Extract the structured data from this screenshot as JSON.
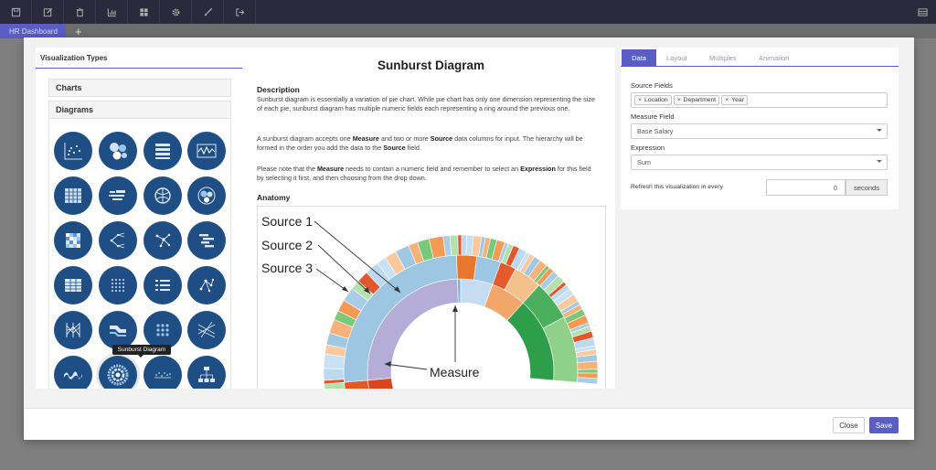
{
  "toolbar": {
    "buttons": [
      "save-icon",
      "edit-icon",
      "trash-icon",
      "bar-chart-icon",
      "dashboard-icon",
      "gear-icon",
      "brush-icon",
      "export-icon"
    ],
    "right_button": "menu-icon"
  },
  "tabbar": {
    "dashboard_tab": "HR Dashboard",
    "add_label": "+"
  },
  "left": {
    "title": "Visualization Types",
    "sections": [
      "Charts",
      "Diagrams"
    ],
    "tooltip": "Sunburst Diagram"
  },
  "main": {
    "title": "Sunburst Diagram",
    "description_heading": "Description",
    "paragraph1": "Sunburst diagram is essentially a variation of pie chart. While pie chart has only one dimension representing the size of each pie, sunburst diagram has multiple numeric fields each representing a ring around the previous one.",
    "anatomy_heading": "Anatomy",
    "anatomy_labels": {
      "source1": "Source 1",
      "source2": "Source 2",
      "source3": "Source 3",
      "measure": "Measure"
    }
  },
  "right": {
    "tabs": [
      "Data",
      "Layout",
      "Multiples",
      "Animation"
    ],
    "source_fields_label": "Source Fields",
    "source_fields": [
      "Location",
      "Department",
      "Year"
    ],
    "measure_field_label": "Measure Field",
    "measure_field_value": "Base Salary",
    "expression_label": "Expression",
    "expression_value": "Sum",
    "refresh_label": "Refresh this visualization in every",
    "refresh_value": "0",
    "refresh_unit": "seconds"
  },
  "footer": {
    "close_label": "Close",
    "save_label": "Save"
  },
  "colors": {
    "accent": "#5a5ec4",
    "topbar": "#2b2a3d",
    "icon_circle": "#1f4e85"
  }
}
